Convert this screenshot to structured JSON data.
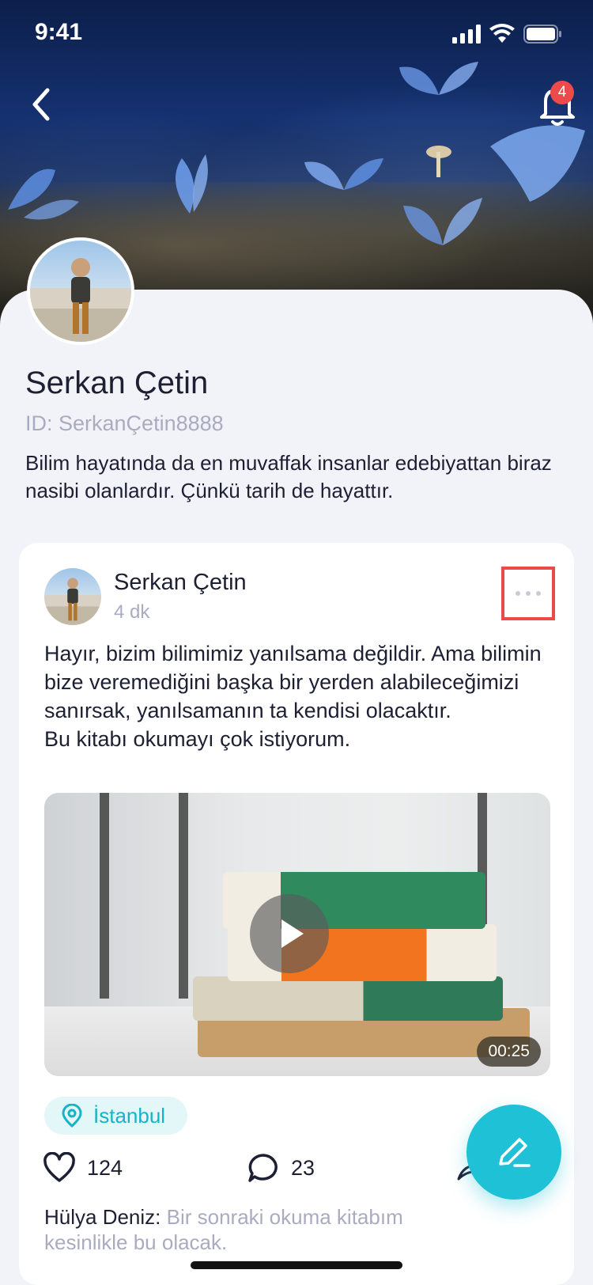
{
  "status_bar": {
    "time": "9:41"
  },
  "header": {
    "notification_count": "4"
  },
  "profile": {
    "name": "Serkan Çetin",
    "id": "ID: SerkanÇetin8888",
    "bio": "Bilim hayatında da en muvaffak insanlar edebiyattan biraz nasibi olanlardır. Çünkü tarih de hayattır."
  },
  "post": {
    "author": "Serkan Çetin",
    "time": "4 dk",
    "text_lines": [
      "Hayır, bizim bilimimiz yanılsama değildir. Ama bilimin bize veremediğini başka bir yerden alabileceğimizi sanırsak, yanılsamanın ta kendisi olacaktır.",
      "Bu kitabı okumayı çok istiyorum."
    ],
    "video_duration": "00:25",
    "location": "İstanbul",
    "likes": "124",
    "comments": "23",
    "comment_preview": {
      "author": "Hülya Deniz:",
      "text": " Bir sonraki okuma kitabım kesinlikle bu olacak."
    }
  },
  "icons": {
    "back": "chevron-left-icon",
    "bell": "bell-icon",
    "more": "more-horizontal-icon",
    "play": "play-icon",
    "location": "location-pin-icon",
    "like": "heart-icon",
    "comment": "comment-bubble-icon",
    "share": "share-icon",
    "compose": "pencil-icon"
  },
  "colors": {
    "accent": "#1ec1d6",
    "badge": "#ef4a4a",
    "text_primary": "#1d1f33",
    "text_secondary": "#a9acc1",
    "highlight_outline": "#e94a4a"
  }
}
